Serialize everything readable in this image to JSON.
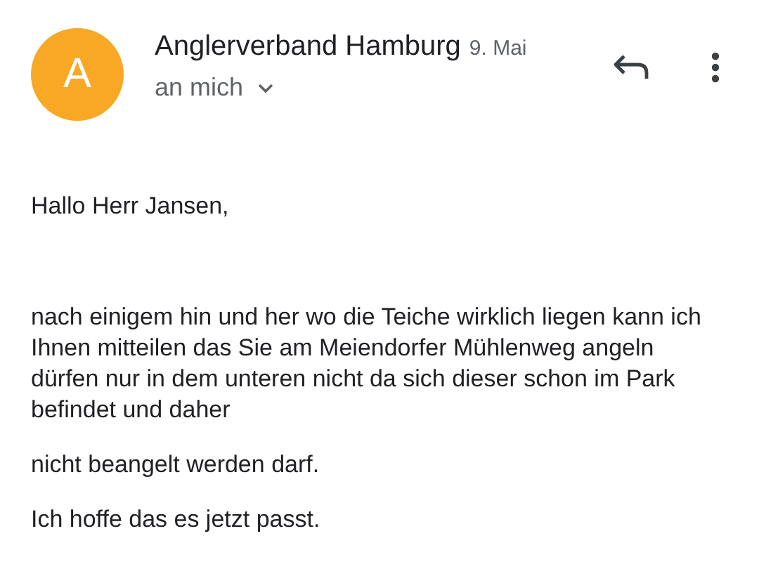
{
  "sender": {
    "initial": "A",
    "color": "#f9a825",
    "name": "Anglerverband Hamburg",
    "date": "9. Mai",
    "recipient": "an mich"
  },
  "body": {
    "greeting": "Hallo Herr Jansen,",
    "paragraphs": [
      "nach einigem hin und her wo die Teiche wirklich liegen kann ich Ihnen mitteilen das Sie am Meiendorfer Mühlenweg angeln dürfen nur in dem unteren nicht da sich dieser schon im Park befindet und daher",
      "nicht beangelt werden darf.",
      "Ich hoffe das es jetzt passt."
    ]
  }
}
